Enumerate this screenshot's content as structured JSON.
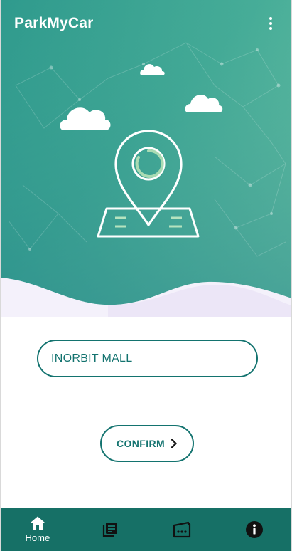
{
  "app": {
    "title": "ParkMyCar",
    "menu_icon": "more-vert-icon"
  },
  "colors": {
    "primary": "#167066",
    "accent": "#13736f",
    "hero_gradient_top": "#6cc4a4",
    "hero_gradient_bottom": "#1d8a8a",
    "background": "#f4f1fb"
  },
  "hero": {
    "illustration_icons": [
      "cloud-icon",
      "map-pin-icon",
      "parking-lot-icon"
    ]
  },
  "location_field": {
    "value": "INORBIT MALL",
    "placeholder": ""
  },
  "confirm_button": {
    "label": "CONFIRM",
    "icon": "chevron-right-icon"
  },
  "bottom_nav": {
    "items": [
      {
        "label": "Home",
        "icon": "home-icon",
        "selected": true
      },
      {
        "label": "",
        "icon": "history-icon",
        "selected": false
      },
      {
        "label": "",
        "icon": "ticket-icon",
        "selected": false
      },
      {
        "label": "",
        "icon": "info-icon",
        "selected": false
      }
    ]
  }
}
